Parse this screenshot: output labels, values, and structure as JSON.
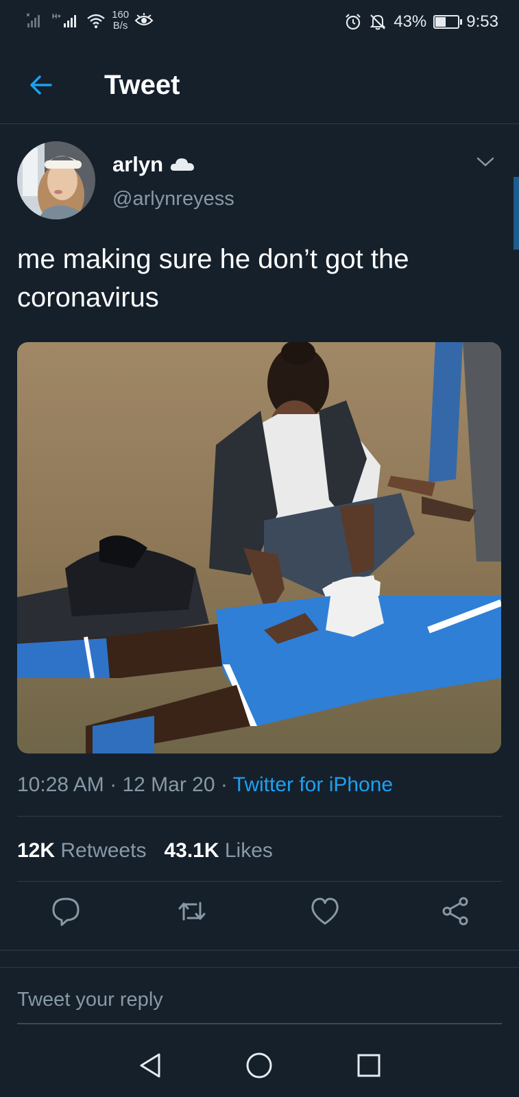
{
  "status_bar": {
    "network_label": "H+",
    "speed_value": "160",
    "speed_unit": "B/s",
    "battery": "43%",
    "battery_level": 0.43,
    "time": "9:53"
  },
  "header": {
    "title": "Tweet"
  },
  "tweet": {
    "author_name": "arlyn",
    "author_handle": "@arlynreyess",
    "text": "me making sure he don’t got the coronavirus",
    "time": "10:28 AM",
    "date": "12 Mar 20",
    "separator": "·",
    "source": "Twitter for iPhone",
    "retweets_count": "12K",
    "retweets_label": "Retweets",
    "likes_count": "43.1K",
    "likes_label": "Likes"
  },
  "reply": {
    "placeholder": "Tweet your reply"
  },
  "colors": {
    "background": "#15202b",
    "accent": "#1da1f2",
    "secondary_text": "#8899a6",
    "divider": "#2f3b47"
  },
  "icons": {
    "back": "arrow-left-icon",
    "badge": "cloud-icon",
    "more": "chevron-down-icon",
    "reply": "comment-icon",
    "retweet": "retweet-icon",
    "like": "heart-icon",
    "share": "share-icon"
  }
}
